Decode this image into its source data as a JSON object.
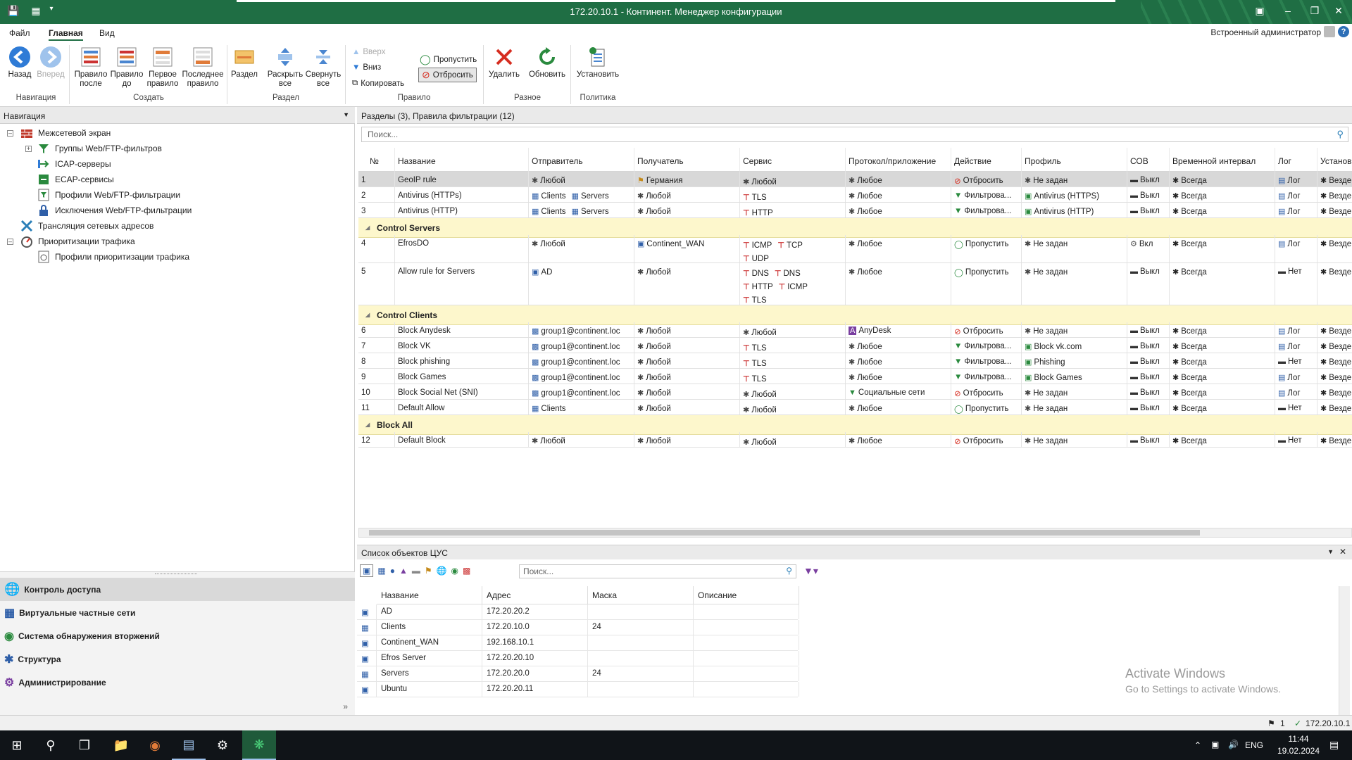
{
  "window": {
    "title": "172.20.10.1 - Континент. Менеджер конфигурации"
  },
  "menu": {
    "tabs": [
      "Файл",
      "Главная",
      "Вид"
    ],
    "user": "Встроенный администратор"
  },
  "ribbon": {
    "back": "Назад",
    "forward": "Вперед",
    "rule_after": [
      "Правило",
      "после"
    ],
    "rule_before": [
      "Правило",
      "до"
    ],
    "first_rule": [
      "Первое",
      "правило"
    ],
    "last_rule": [
      "Последнее",
      "правило"
    ],
    "section": "Раздел",
    "expand_all": [
      "Раскрыть",
      "все"
    ],
    "collapse_all": [
      "Свернуть",
      "все"
    ],
    "up": "Вверх",
    "down": "Вниз",
    "copy": "Копировать",
    "pass": "Пропустить",
    "drop": "Отбросить",
    "delete": "Удалить",
    "refresh": "Обновить",
    "install": "Установить",
    "groups": {
      "nav": "Навигация",
      "create": "Создать",
      "section": "Раздел",
      "rule": "Правило",
      "misc": "Разное",
      "policy": "Политика"
    }
  },
  "nav": {
    "header": "Навигация",
    "tree": [
      {
        "label": "Межсетевой экран",
        "icon": "firewall-icon"
      },
      {
        "label": "Группы Web/FTP-фильтров",
        "icon": "filter-group-icon"
      },
      {
        "label": "ICAP-серверы",
        "icon": "icap-server-icon"
      },
      {
        "label": "ECAP-сервисы",
        "icon": "ecap-service-icon"
      },
      {
        "label": "Профили Web/FTP-фильтрации",
        "icon": "filter-profile-icon"
      },
      {
        "label": "Исключения Web/FTP-фильтрации",
        "icon": "lock-icon"
      },
      {
        "label": "Трансляция сетевых адресов",
        "icon": "nat-icon"
      },
      {
        "label": "Приоритизации трафика",
        "icon": "priority-icon"
      },
      {
        "label": "Профили приоритизации трафика",
        "icon": "priority-profile-icon"
      }
    ],
    "bottom": [
      "Контроль доступа",
      "Виртуальные частные сети",
      "Система обнаружения вторжений",
      "Структура",
      "Администрирование"
    ]
  },
  "main": {
    "header": "Разделы (3), Правила фильтрации (12)",
    "search_placeholder": "Поиск...",
    "columns": [
      "№",
      "Название",
      "Отправитель",
      "Получатель",
      "Сервис",
      "Протокол/приложение",
      "Действие",
      "Профиль",
      "СОВ",
      "Временной интервал",
      "Лог",
      "Установить"
    ],
    "rows": [
      {
        "n": "1",
        "name": "GeoIP rule",
        "sender": [
          "Любой"
        ],
        "recv": [
          "Германия"
        ],
        "service": [
          "Любой"
        ],
        "proto": "Любое",
        "action": "Отбросить",
        "profile": "Не задан",
        "ids": "Выкл",
        "time": "Всегда",
        "log": "Лог",
        "inst": "Везде"
      },
      {
        "n": "2",
        "name": "Antivirus (HTTPs)",
        "sender": [
          "Clients",
          "Servers"
        ],
        "recv": [
          "Любой"
        ],
        "service": [
          "TLS"
        ],
        "proto": "Любое",
        "action": "Фильтрова...",
        "profile": "Antivirus (HTTPS)",
        "ids": "Выкл",
        "time": "Всегда",
        "log": "Лог",
        "inst": "Везде"
      },
      {
        "n": "3",
        "name": "Antivirus (HTTP)",
        "sender": [
          "Clients",
          "Servers"
        ],
        "recv": [
          "Любой"
        ],
        "service": [
          "HTTP"
        ],
        "proto": "Любое",
        "action": "Фильтрова...",
        "profile": "Antivirus (HTTP)",
        "ids": "Выкл",
        "time": "Всегда",
        "log": "Лог",
        "inst": "Везде"
      },
      {
        "n": "4",
        "name": "EfrosDO",
        "sender": [
          "Любой"
        ],
        "recv": [
          "Continent_WAN"
        ],
        "service": [
          "ICMP",
          "TCP",
          "UDP"
        ],
        "proto": "Любое",
        "action": "Пропустить",
        "profile": "Не задан",
        "ids": "Вкл",
        "time": "Всегда",
        "log": "Лог",
        "inst": "Везде"
      },
      {
        "n": "5",
        "name": "Allow rule for Servers",
        "sender": [
          "AD"
        ],
        "recv": [
          "Любой"
        ],
        "service": [
          "DNS",
          "DNS",
          "HTTP",
          "ICMP",
          "TLS"
        ],
        "proto": "Любое",
        "action": "Пропустить",
        "profile": "Не задан",
        "ids": "Выкл",
        "time": "Всегда",
        "log": "Нет",
        "inst": "Везде"
      },
      {
        "n": "6",
        "name": "Block Anydesk",
        "sender": [
          "group1@continent.loc"
        ],
        "recv": [
          "Любой"
        ],
        "service": [
          "Любой"
        ],
        "proto": "AnyDesk",
        "action": "Отбросить",
        "profile": "Не задан",
        "ids": "Выкл",
        "time": "Всегда",
        "log": "Лог",
        "inst": "Везде"
      },
      {
        "n": "7",
        "name": "Block VK",
        "sender": [
          "group1@continent.loc"
        ],
        "recv": [
          "Любой"
        ],
        "service": [
          "TLS"
        ],
        "proto": "Любое",
        "action": "Фильтрова...",
        "profile": "Block vk.com",
        "ids": "Выкл",
        "time": "Всегда",
        "log": "Лог",
        "inst": "Везде"
      },
      {
        "n": "8",
        "name": "Block phishing",
        "sender": [
          "group1@continent.loc"
        ],
        "recv": [
          "Любой"
        ],
        "service": [
          "TLS"
        ],
        "proto": "Любое",
        "action": "Фильтрова...",
        "profile": "Phishing",
        "ids": "Выкл",
        "time": "Всегда",
        "log": "Нет",
        "inst": "Везде"
      },
      {
        "n": "9",
        "name": "Block Games",
        "sender": [
          "group1@continent.loc"
        ],
        "recv": [
          "Любой"
        ],
        "service": [
          "TLS"
        ],
        "proto": "Любое",
        "action": "Фильтрова...",
        "profile": "Block Games",
        "ids": "Выкл",
        "time": "Всегда",
        "log": "Лог",
        "inst": "Везде"
      },
      {
        "n": "10",
        "name": "Block Social Net (SNI)",
        "sender": [
          "group1@continent.loc"
        ],
        "recv": [
          "Любой"
        ],
        "service": [
          "Любой"
        ],
        "proto": "Социальные сети",
        "action": "Отбросить",
        "profile": "Не задан",
        "ids": "Выкл",
        "time": "Всегда",
        "log": "Лог",
        "inst": "Везде"
      },
      {
        "n": "11",
        "name": "Default Allow",
        "sender": [
          "Clients"
        ],
        "recv": [
          "Любой"
        ],
        "service": [
          "Любой"
        ],
        "proto": "Любое",
        "action": "Пропустить",
        "profile": "Не задан",
        "ids": "Выкл",
        "time": "Всегда",
        "log": "Нет",
        "inst": "Везде"
      },
      {
        "n": "12",
        "name": "Default Block",
        "sender": [
          "Любой"
        ],
        "recv": [
          "Любой"
        ],
        "service": [
          "Любой"
        ],
        "proto": "Любое",
        "action": "Отбросить",
        "profile": "Не задан",
        "ids": "Выкл",
        "time": "Всегда",
        "log": "Нет",
        "inst": "Везде"
      }
    ],
    "sections": [
      "Control Servers",
      "Control Clients",
      "Block All"
    ]
  },
  "objects": {
    "header": "Список объектов ЦУС",
    "search_placeholder": "Поиск...",
    "columns": [
      "Название",
      "Адрес",
      "Маска",
      "Описание"
    ],
    "rows": [
      {
        "name": "AD",
        "addr": "172.20.20.2",
        "mask": "",
        "desc": ""
      },
      {
        "name": "Clients",
        "addr": "172.20.10.0",
        "mask": "24",
        "desc": ""
      },
      {
        "name": "Continent_WAN",
        "addr": "192.168.10.1",
        "mask": "",
        "desc": ""
      },
      {
        "name": "Efros Server",
        "addr": "172.20.20.10",
        "mask": "",
        "desc": ""
      },
      {
        "name": "Servers",
        "addr": "172.20.20.0",
        "mask": "24",
        "desc": ""
      },
      {
        "name": "Ubuntu",
        "addr": "172.20.20.11",
        "mask": "",
        "desc": ""
      }
    ]
  },
  "watermark": {
    "line1": "Activate Windows",
    "line2": "Go to Settings to activate Windows."
  },
  "status": {
    "flag_count": "1",
    "server": "172.20.10.1"
  },
  "taskbar": {
    "lang": "ENG",
    "time": "11:44",
    "date": "19.02.2024"
  },
  "colors": {
    "titlebar": "#1f6e44",
    "section_row": "#fdf7cc",
    "selected_row": "#d8d8d8",
    "drop": "#d62d20",
    "pass": "#2a8a3e"
  }
}
